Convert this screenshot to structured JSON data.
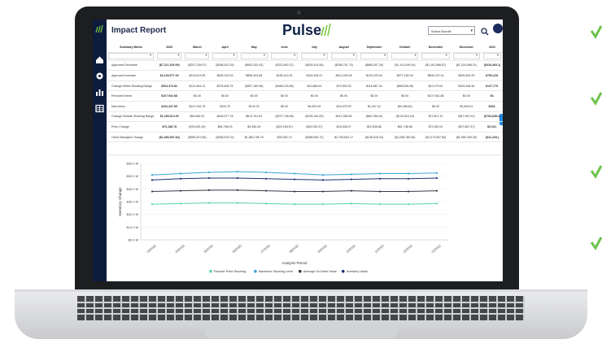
{
  "app": {
    "title": "Impact Report",
    "brand": "Pulse",
    "selector_value": "Select Bundle",
    "icons": [
      "logo-icon",
      "home-icon",
      "settings-icon",
      "chart-icon",
      "table-icon",
      "search-icon",
      "user-avatar"
    ]
  },
  "table": {
    "headers": [
      "Summary Metric",
      "2020",
      "March",
      "April",
      "May",
      "June",
      "July",
      "August",
      "September",
      "October",
      "November",
      "December",
      "2021"
    ],
    "rows": [
      {
        "label": "Approved Decrease",
        "values": [
          "($7,111,205.99)",
          "($257,318.97)",
          "($288,510.25)",
          "($953,432.43)",
          "($332,840.37)",
          "($428,514.08)",
          "($298,751.74)",
          "($885,407.26)",
          "($1,141,049.04)",
          "($1,161,988.87)",
          "($1,104,088.21)",
          "($418,469.1)"
        ]
      },
      {
        "label": "Approved Increase",
        "values": [
          "$4,138,577.49",
          "$219,613.55",
          "$835,129.33",
          "$808,434.88",
          "$185,314.41",
          "$162,408.11",
          "$514,328.48",
          "$149,220.54",
          "$577,182.54",
          "$808,122.14",
          "$490,804.99",
          "$750,415."
        ]
      },
      {
        "label": "Change Within Stocking Range",
        "values": [
          "$303,373.82",
          "$131,564.31",
          "$376,608.75",
          "($357,189.98)",
          "($488,109.88)",
          "$10,886.63",
          "$70,599.33",
          "$116,887.34",
          "($88,545.08)",
          "$12,479.61",
          "$109,448.46",
          "$137,776."
        ]
      },
      {
        "label": "Removed Items",
        "values": [
          "$107,942.88",
          "$0.00",
          "$0.00",
          "$0.00",
          "$0.00",
          "$0.00",
          "$0.00",
          "$0.00",
          "$0.00",
          "$107,942.88",
          "$0.00",
          "$0."
        ]
      },
      {
        "label": "New Items",
        "values": [
          "$102,437.85",
          "$147,916.78",
          "$116.75",
          "$143.32",
          "$0.00",
          "$4,503.99",
          "$16,979.93",
          "$1,347.41",
          "($9,498.61)",
          "$0.00",
          "$2,828.61",
          "$282."
        ]
      },
      {
        "label": "Change Outside Stocking Range",
        "values": [
          "$1,298,513.05",
          "$95,848.32",
          "$448,977.78",
          "$613,751.62",
          "($227,748.98)",
          "($235,140.05)",
          "$912,355.89",
          "($85,788.29)",
          "($133,516.29)",
          "$72,807.41",
          "($47,992.91)",
          "($766,838.2)"
        ]
      },
      {
        "label": "Price Change",
        "values": [
          "$70,188.78",
          "($76,835.16)",
          "$84,798.23",
          "$3,356.28",
          "($29,198.57)",
          "($26,930.37)",
          "$16,538.37",
          "$22,836.66",
          "$61,748.68",
          "$72,350.91",
          "($37,867.37)",
          "$5,161."
        ]
      },
      {
        "label": "Client Managed Change",
        "values": [
          "($2,480,087.84)",
          "($965,307.88)",
          "($268,578.31)",
          "$1,883,786.76",
          "$39,352.74",
          "($388,556.72)",
          "$2,736,603.17",
          "($136,616.03)",
          "($1,058,780.65)",
          "($1,073,957.89)",
          "($2,980,309.30)",
          "($41,228.)"
        ]
      }
    ]
  },
  "chart_data": {
    "type": "line",
    "x": [
      "03/2020",
      "04/2020",
      "05/2020",
      "06/2020",
      "07/2020",
      "08/2020",
      "09/2020",
      "10/2020",
      "11/2020",
      "12/2020",
      "01/2021"
    ],
    "ylabel": "Inventory Change",
    "xlabel": "Analysis Period",
    "yticks": [
      "$0.0 M",
      "$10.0 M",
      "$20.0 M",
      "$30.0 M",
      "$40.0 M",
      "$50.0 M",
      "$60.0 M"
    ],
    "ylim": [
      0,
      60
    ],
    "series": [
      {
        "name": "Reorder Point Stocking",
        "color": "#5ad3b0",
        "values": [
          28,
          28.5,
          29,
          29,
          28.5,
          28,
          28,
          28.5,
          28,
          28,
          28.5
        ]
      },
      {
        "name": "Maximum Stocking Level",
        "color": "#3da5d9",
        "values": [
          51,
          52,
          53,
          53.5,
          53,
          52,
          51,
          51.5,
          52,
          52,
          52.5
        ]
      },
      {
        "name": "Average On-Hand Value",
        "color": "#333a45",
        "values": [
          38,
          38.5,
          39,
          39,
          38.5,
          38,
          38,
          38.5,
          38,
          38,
          38.5
        ]
      },
      {
        "name": "Inventory Value",
        "color": "#1c2f73",
        "values": [
          47,
          48,
          48.5,
          48.5,
          48,
          47.5,
          47,
          47.5,
          48,
          48,
          48.5
        ]
      }
    ],
    "legend": "bottom",
    "grid": true
  },
  "colors": {
    "sidebar": "#0d1b3c",
    "accent": "#1e88e5",
    "brand_mark": "#7ac943"
  }
}
